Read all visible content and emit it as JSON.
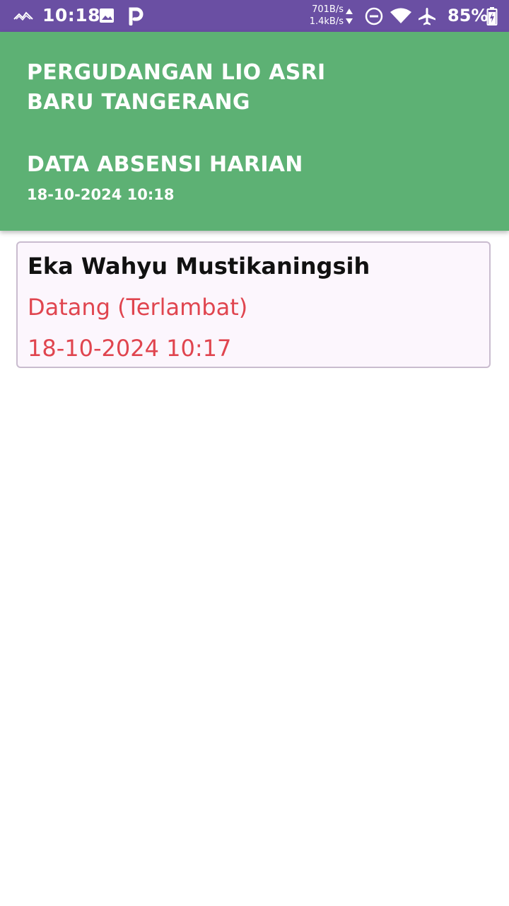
{
  "status_bar": {
    "time": "10:18",
    "net_up": "701B/s",
    "net_down": "1.4kB/s",
    "battery": "85%",
    "icons": [
      "signal-wave-icon",
      "image-icon",
      "p-app-icon",
      "data-arrows-icon",
      "dnd-icon",
      "wifi-icon",
      "airplane-icon",
      "battery-charging-icon"
    ]
  },
  "header": {
    "company_line1": "PERGUDANGAN LIO ASRI",
    "company_line2": "BARU TANGERANG",
    "title": "DATA ABSENSI HARIAN",
    "datetime": "18-10-2024 10:18",
    "background": "#5db174"
  },
  "records": [
    {
      "name": "Eka Wahyu Mustikaningsih",
      "status": "Datang (Terlambat)",
      "timestamp": "18-10-2024 10:17",
      "status_color": "#e0454f"
    }
  ]
}
